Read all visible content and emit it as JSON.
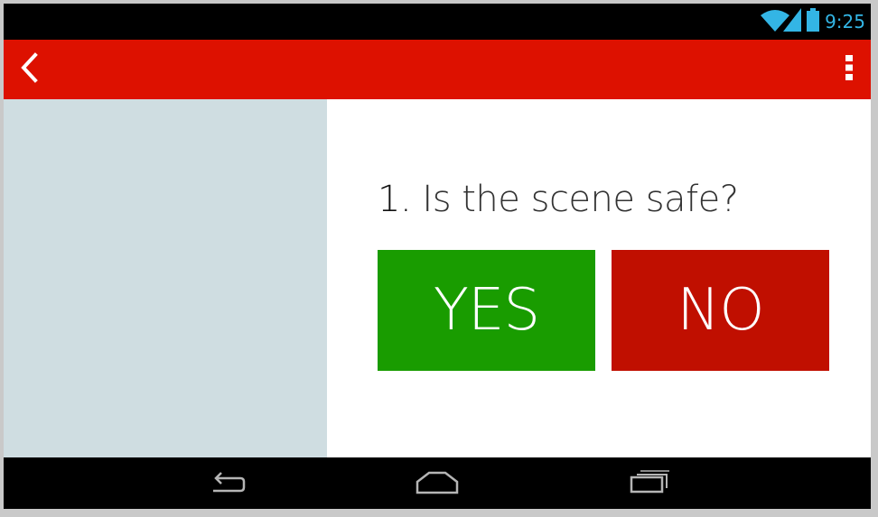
{
  "status_bar": {
    "time": "9:25",
    "wifi_icon": "wifi-icon",
    "signal_icon": "signal-icon",
    "battery_icon": "battery-icon",
    "accent_color": "#33b5e5"
  },
  "action_bar": {
    "back_icon": "chevron-left-icon",
    "overflow_icon": "overflow-menu-icon",
    "color": "#dd1100"
  },
  "question": {
    "number": "1.",
    "text": "Is the scene safe?"
  },
  "answers": {
    "yes_label": "YES",
    "no_label": "NO",
    "yes_color": "#199c00",
    "no_color": "#c00f00"
  },
  "side_panel": {
    "color": "#cfdde1"
  },
  "nav_bar": {
    "back_icon": "nav-back-icon",
    "home_icon": "nav-home-icon",
    "recents_icon": "nav-recents-icon"
  }
}
